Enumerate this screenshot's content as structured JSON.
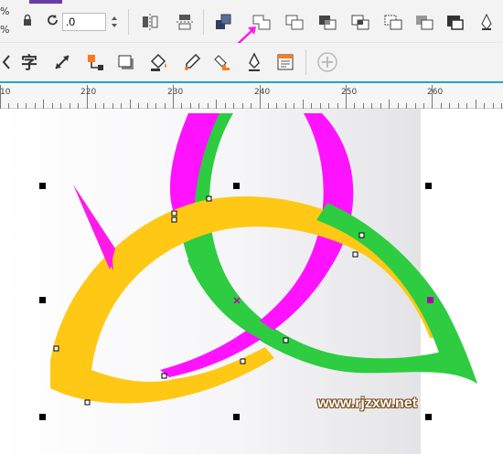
{
  "toolbar1": {
    "percent_symbols": [
      "%",
      "%"
    ],
    "rotate_value": ".0",
    "icons": [
      "lock-icon",
      "rotate-icon",
      "mirror-horizontal-icon",
      "mirror-vertical-icon",
      "arrange-front-icon",
      "weld-icon",
      "trim-icon",
      "intersect-icon",
      "simplify-icon",
      "front-minus-back-icon",
      "back-minus-front-icon",
      "create-boundary-icon",
      "pen-tip-icon"
    ]
  },
  "toolbar2": {
    "text_glyph": "字",
    "icons": [
      "curve-icon",
      "text-tool-icon",
      "dimension-tool-icon",
      "connector-tool-icon",
      "drop-shadow-icon",
      "fill-bucket-icon",
      "eyedropper-icon",
      "interactive-fill-icon",
      "outline-pen-icon",
      "smart-fill-icon",
      "add-icon"
    ]
  },
  "ruler": {
    "labels": [
      "10",
      "220",
      "230",
      "240",
      "250",
      "260"
    ]
  },
  "colors": {
    "magenta": "#ff12ff",
    "green": "#2ecc40",
    "yellow": "#ffc815",
    "accent": "#1aa8c7",
    "arrow": "#ff1ae8"
  },
  "watermark": "www.rjzxw.net"
}
